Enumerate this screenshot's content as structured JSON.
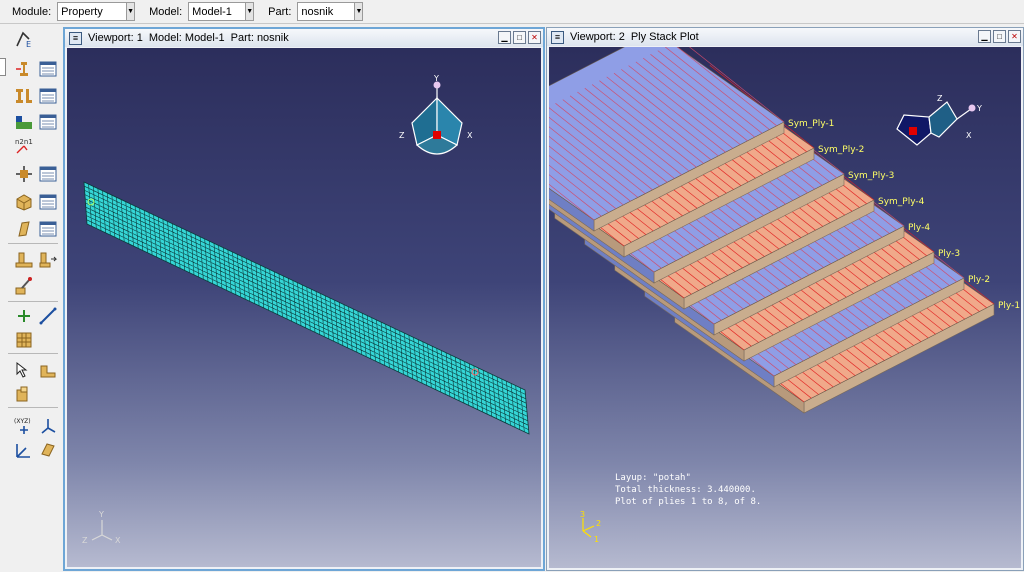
{
  "topbar": {
    "module_label": "Module:",
    "module_value": "Property",
    "model_label": "Model:",
    "model_value": "Model-1",
    "part_label": "Part:",
    "part_value": "nosnik"
  },
  "viewport1": {
    "title": "Viewport: 1",
    "model": "Model: Model-1",
    "part": "Part: nosnik",
    "triad": {
      "x": "X",
      "y": "Y",
      "z": "Z"
    },
    "view_cube": {
      "x": "X",
      "y": "Y",
      "z": "Z"
    }
  },
  "viewport2": {
    "title": "Viewport: 2",
    "subtitle": "Ply Stack Plot",
    "plies": [
      "Sym_Ply-1",
      "Sym_Ply-2",
      "Sym_Ply-3",
      "Sym_Ply-4",
      "Ply-4",
      "Ply-3",
      "Ply-2",
      "Ply-1"
    ],
    "info_line1": "Layup: \"potah\"",
    "info_line2": "Total thickness: 3.440000.",
    "info_line3": "Plot of plies 1 to 8, of 8.",
    "triad": {
      "x": "1",
      "y": "2",
      "z": "3"
    },
    "view_cube": {
      "x": "X",
      "y": "Y",
      "z": "Z"
    }
  },
  "colors": {
    "mesh": "#35d6d6",
    "ply_blue": "#8f9ee6",
    "ply_orange": "#f0a98a",
    "ply_side": "#c9ad8e",
    "ply_line_red": "#e02020",
    "label_yellow": "#ffff66",
    "triad_yellow": "#ffe000"
  },
  "icons": [
    "create-material-icon",
    "assign-section-icon",
    "create-section-icon",
    "section-manager-icon",
    "create-profile-icon",
    "profile-manager-icon",
    "special-icon",
    "orientation-icon",
    "orientation-manager-icon",
    "skin-icon",
    "skin-manager-icon",
    "stringer-icon",
    "stringer-manager-icon",
    "composite-layup-icon",
    "composite-manager-icon",
    "inertia-icon",
    "inertia-edit-icon",
    "spring-icon",
    "datum-point-icon",
    "datum-axis-icon",
    "datum-grid-icon",
    "query-icon",
    "partition-icon",
    "display-icon",
    "datum-csys-icon",
    "axis-csys-icon",
    "beam-orient-icon",
    "plane-icon"
  ]
}
